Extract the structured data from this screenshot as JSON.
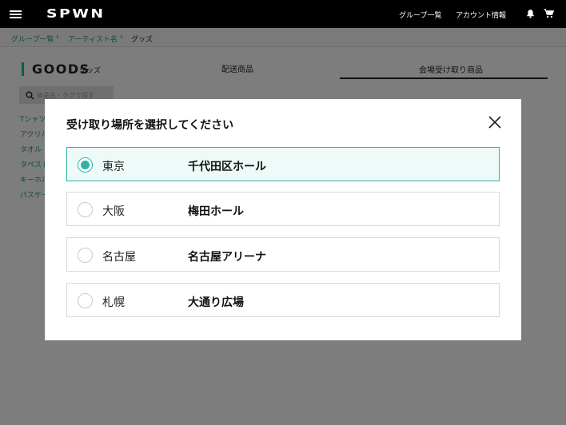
{
  "header": {
    "logo": "SPWN",
    "nav": [
      {
        "label": "グループ一覧"
      },
      {
        "label": "アカウント情報"
      }
    ]
  },
  "breadcrumb": [
    {
      "label": "グループ一覧"
    },
    {
      "label": "アーティスト名"
    },
    {
      "label": "グッズ"
    }
  ],
  "goods": {
    "title": "GOODS",
    "subtitle": "グッズ",
    "tabs": [
      {
        "label": "配送商品"
      },
      {
        "label": "会場受け取り商品",
        "active": true
      }
    ],
    "search_placeholder": "商品名・タグで探す",
    "categories": [
      "Tシャツ",
      "アクリル",
      "タオル",
      "タペスト",
      "キーホル",
      "パスケー"
    ]
  },
  "modal": {
    "title": "受け取り場所を選択してください",
    "options": [
      {
        "city": "東京",
        "venue": "千代田区ホール",
        "selected": true
      },
      {
        "city": "大阪",
        "venue": "梅田ホール",
        "selected": false
      },
      {
        "city": "名古屋",
        "venue": "名古屋アリーナ",
        "selected": false
      },
      {
        "city": "札幌",
        "venue": "大通り広場",
        "selected": false
      }
    ]
  },
  "colors": {
    "accent": "#2bb5a3",
    "header_bg": "#000000",
    "overlay": "#7d7d7d"
  },
  "icons": [
    "menu-icon",
    "bell-icon",
    "cart-icon",
    "search-icon",
    "close-icon",
    "chevron-right-icon"
  ]
}
